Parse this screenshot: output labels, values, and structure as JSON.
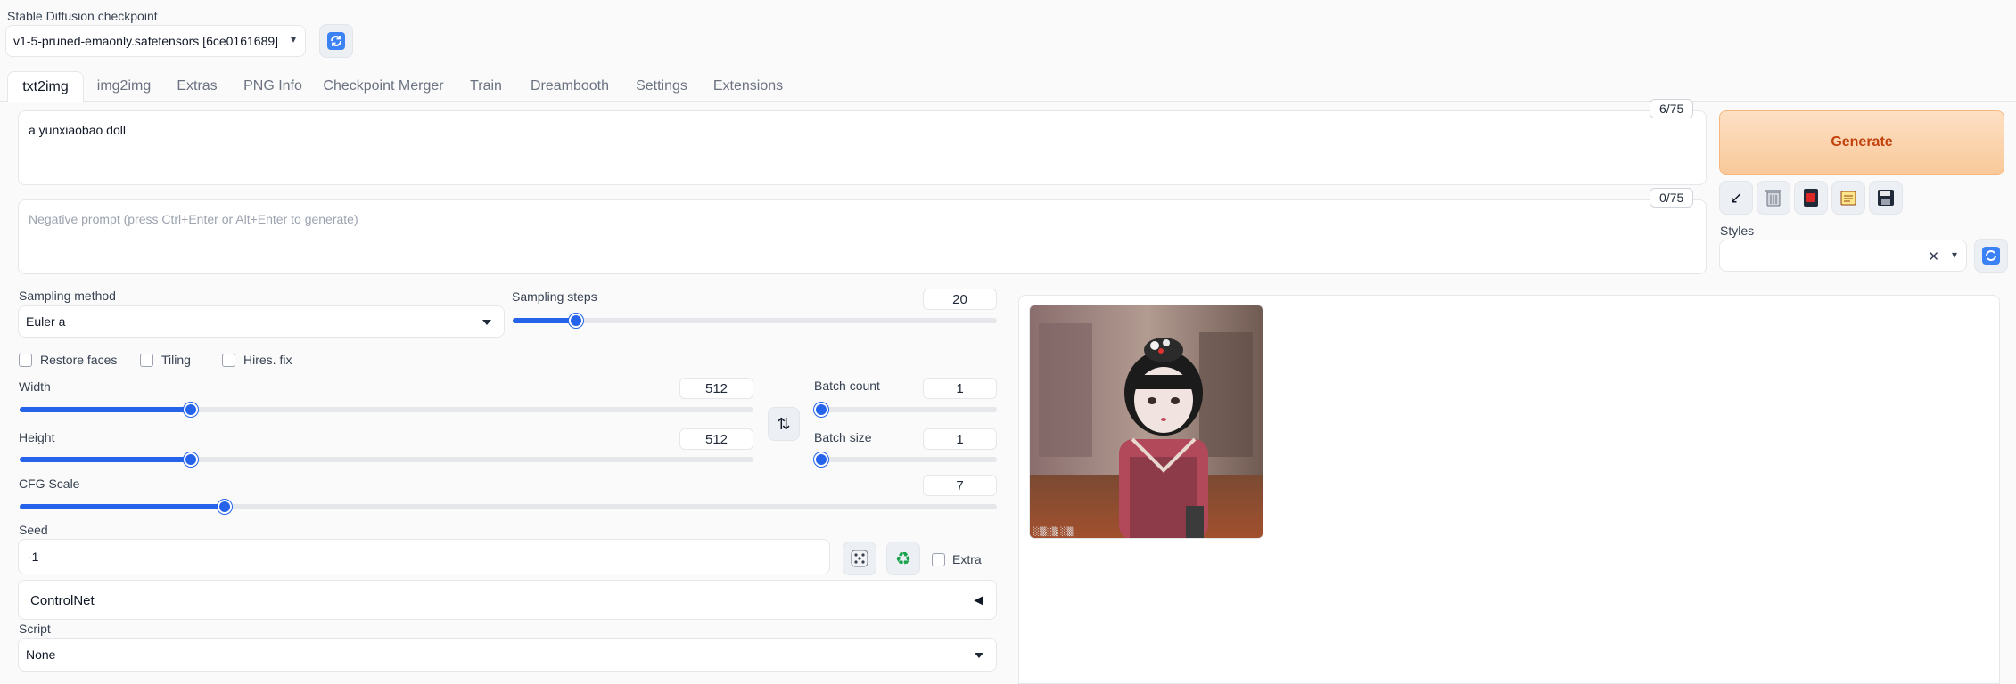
{
  "checkpoint": {
    "label": "Stable Diffusion checkpoint",
    "value": "v1-5-pruned-emaonly.safetensors [6ce0161689]"
  },
  "tabs": [
    {
      "label": "txt2img"
    },
    {
      "label": "img2img"
    },
    {
      "label": "Extras"
    },
    {
      "label": "PNG Info"
    },
    {
      "label": "Checkpoint Merger"
    },
    {
      "label": "Train"
    },
    {
      "label": "Dreambooth"
    },
    {
      "label": "Settings"
    },
    {
      "label": "Extensions"
    }
  ],
  "prompt": {
    "value": "a yunxiaobao doll",
    "counter": "6/75"
  },
  "negative_prompt": {
    "placeholder": "Negative prompt (press Ctrl+Enter or Alt+Enter to generate)",
    "counter": "0/75"
  },
  "generate": {
    "label": "Generate"
  },
  "tool_icons": [
    "arrow-icon",
    "trash-icon",
    "card-icon",
    "clipboard-icon",
    "save-icon"
  ],
  "styles": {
    "label": "Styles",
    "value": ""
  },
  "sampling_method": {
    "label": "Sampling method",
    "value": "Euler a"
  },
  "sampling_steps": {
    "label": "Sampling steps",
    "value": "20",
    "fraction": 0.13
  },
  "checkboxes": {
    "restore_faces": "Restore faces",
    "tiling": "Tiling",
    "hires_fix": "Hires. fix"
  },
  "width": {
    "label": "Width",
    "value": "512",
    "fraction": 0.233
  },
  "height": {
    "label": "Height",
    "value": "512",
    "fraction": 0.233
  },
  "batch_count": {
    "label": "Batch count",
    "value": "1",
    "fraction": 0.0
  },
  "batch_size": {
    "label": "Batch size",
    "value": "1",
    "fraction": 0.0
  },
  "cfg_scale": {
    "label": "CFG Scale",
    "value": "7",
    "fraction": 0.21
  },
  "seed": {
    "label": "Seed",
    "value": "-1",
    "extra_label": "Extra"
  },
  "controlnet": {
    "label": "ControlNet",
    "arrow": "◀"
  },
  "script": {
    "label": "Script",
    "value": "None"
  },
  "colors": {
    "accent": "#2563eb",
    "generate_bg": "#fbd5b1",
    "generate_text": "#c2410c"
  }
}
